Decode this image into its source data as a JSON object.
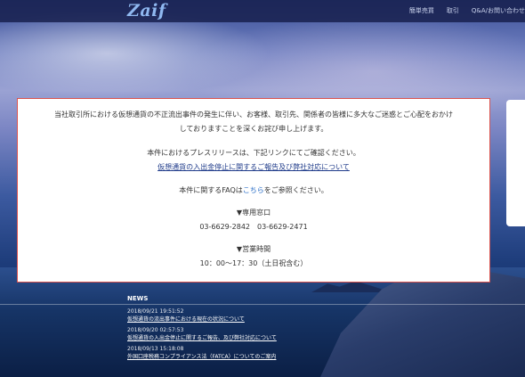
{
  "header": {
    "logo": "Zaif",
    "nav": [
      "簡単売買",
      "取引",
      "Q&A/お問い合わせ"
    ]
  },
  "notice": {
    "line1": "当社取引所における仮想通貨の不正流出事件の発生に伴い、お客様、取引先、関係者の皆様に多大なご迷惑とご心配をおかけ",
    "line2": "しておりますことを深くお詫び申し上げます。",
    "press_text": "本件におけるプレスリリースは、下記リンクにてご確認ください。",
    "press_link": "仮想通貨の入出金停止に関するご報告及び弊社対応について",
    "faq_prefix": "本件に関するFAQは",
    "faq_link": "こちら",
    "faq_suffix": "をご参照ください。",
    "contact_heading": "▼専用窓口",
    "contact_numbers": "03-6629-2842　03-6629-2471",
    "hours_heading": "▼営業時間",
    "hours_value": "10：00～17：30（土日祝含む）"
  },
  "news": {
    "title": "NEWS",
    "items": [
      {
        "date": "2018/09/21 19:51:52",
        "title": "仮想通貨の流出事件における現在の状況について"
      },
      {
        "date": "2018/09/20 02:57:53",
        "title": "仮想通貨の入出金停止に関するご報告、及び弊社対応について"
      },
      {
        "date": "2018/09/13 15:18:08",
        "title": "外国口座税務コンプライアンス法（FATCA）についてのご案内"
      }
    ]
  }
}
